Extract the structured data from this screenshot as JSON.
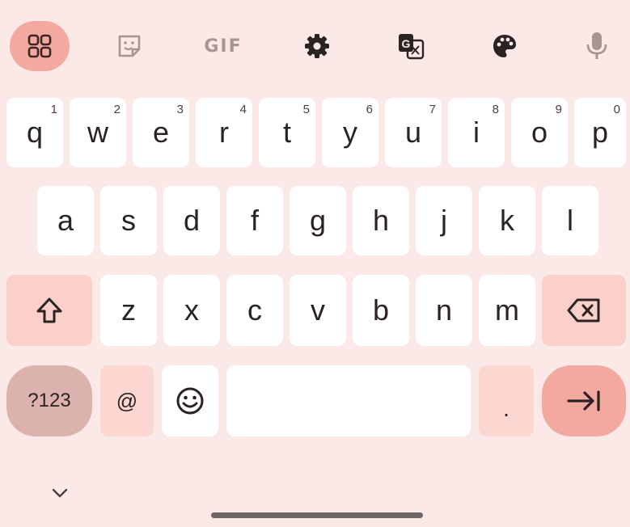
{
  "toolbar": {
    "items": [
      {
        "name": "apps-grid",
        "active": true
      },
      {
        "name": "sticker"
      },
      {
        "name": "gif",
        "label": "GIF"
      },
      {
        "name": "settings"
      },
      {
        "name": "translate"
      },
      {
        "name": "theme-palette"
      },
      {
        "name": "voice-input"
      }
    ],
    "gif_label": "GIF"
  },
  "rows": {
    "row1": [
      {
        "char": "q",
        "hint": "1"
      },
      {
        "char": "w",
        "hint": "2"
      },
      {
        "char": "e",
        "hint": "3"
      },
      {
        "char": "r",
        "hint": "4"
      },
      {
        "char": "t",
        "hint": "5"
      },
      {
        "char": "y",
        "hint": "6"
      },
      {
        "char": "u",
        "hint": "7"
      },
      {
        "char": "i",
        "hint": "8"
      },
      {
        "char": "o",
        "hint": "9"
      },
      {
        "char": "p",
        "hint": "0"
      }
    ],
    "row2": [
      "a",
      "s",
      "d",
      "f",
      "g",
      "h",
      "j",
      "k",
      "l"
    ],
    "row3": [
      "z",
      "x",
      "c",
      "v",
      "b",
      "n",
      "m"
    ]
  },
  "bottom": {
    "symbols_label": "?123",
    "at_label": "@",
    "period_label": "."
  },
  "colors": {
    "background": "#fbe9e7",
    "key": "#ffffff",
    "modifier": "#fbd0cb",
    "accent": "#f3a8a0",
    "symbols": "#dcb2ae",
    "text": "#2b2322"
  }
}
